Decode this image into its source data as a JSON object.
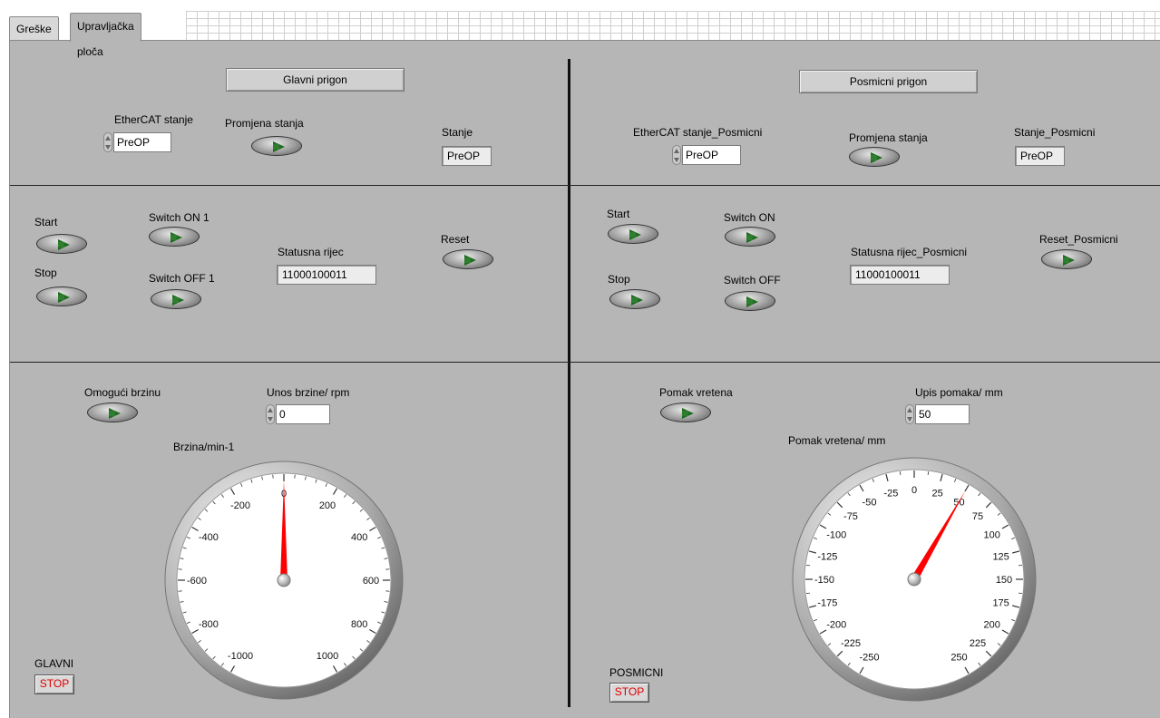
{
  "tabs": [
    {
      "label": "Greške"
    },
    {
      "label": "Upravljačka ploča",
      "active": true
    }
  ],
  "glavni": {
    "section_title": "Glavni prigon",
    "ethercat_label": "EtherCAT stanje",
    "ethercat_value": "PreOP",
    "promjena_label": "Promjena stanja",
    "stanje_label": "Stanje",
    "stanje_value": "PreOP",
    "start_label": "Start",
    "stop_label": "Stop",
    "switch_on_label": "Switch ON 1",
    "switch_off_label": "Switch OFF 1",
    "statusna_label": "Statusna rijec",
    "statusna_value": "11000100011",
    "reset_label": "Reset",
    "omoguci_label": "Omogući brzinu",
    "unos_label": "Unos brzine/ rpm",
    "unos_value": "0",
    "gauge": {
      "title": "Brzina/min-1",
      "value": 0,
      "ticks": [
        "-1000",
        "-800",
        "-600",
        "-400",
        "-200",
        "0",
        "200",
        "400",
        "600",
        "800",
        "1000"
      ]
    },
    "stop_caption": "GLAVNI",
    "stop_button": "STOP"
  },
  "posmicni": {
    "section_title": "Posmicni prigon",
    "ethercat_label": "EtherCAT stanje_Posmicni",
    "ethercat_value": "PreOP",
    "promjena_label": "Promjena stanja",
    "stanje_label": "Stanje_Posmicni",
    "stanje_value": "PreOP",
    "start_label": "Start",
    "stop_label": "Stop",
    "switch_on_label": "Switch ON",
    "switch_off_label": "Switch OFF",
    "statusna_label": "Statusna rijec_Posmicni",
    "statusna_value": "11000100011",
    "reset_label": "Reset_Posmicni",
    "pomak_label": "Pomak vretena",
    "upis_label": "Upis pomaka/ mm",
    "upis_value": "50",
    "gauge": {
      "title": "Pomak vretena/ mm",
      "value": 50,
      "ticks": [
        "-250",
        "-225",
        "-200",
        "-175",
        "-150",
        "-125",
        "-100",
        "-75",
        "-50",
        "-25",
        "0",
        "25",
        "50",
        "75",
        "100",
        "125",
        "150",
        "175",
        "200",
        "225",
        "250"
      ]
    },
    "stop_caption": "POSMICNI",
    "stop_button": "STOP"
  },
  "colors": {
    "panel_bg": "#b6b6b6",
    "needle": "#ff0000",
    "led_green": "#1f6b1f",
    "stop_text": "#e00000"
  }
}
